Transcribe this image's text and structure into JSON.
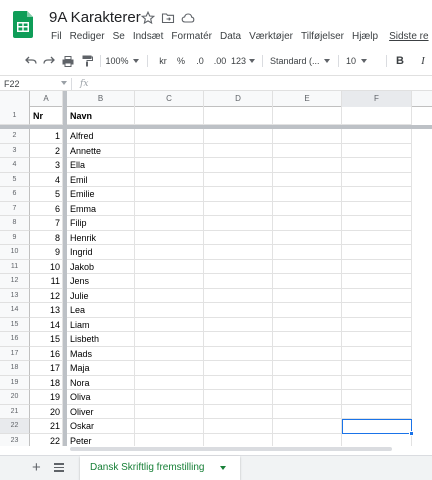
{
  "app": {
    "title": "9A Karakterer",
    "brand_color": "#0f9d58",
    "icons": [
      "star-icon",
      "move-to-folder-icon",
      "cloud-saved-icon"
    ]
  },
  "menu": {
    "items": [
      "Fil",
      "Rediger",
      "Se",
      "Indsæt",
      "Formatér",
      "Data",
      "Værktøjer",
      "Tilføjelser",
      "Hjælp"
    ],
    "last_edit": "Sidste re"
  },
  "toolbar": {
    "zoom": "100%",
    "currency": "kr",
    "percent": "%",
    "decrease_decimals": ".0",
    "increase_decimals": ".00",
    "more_formats": "123",
    "font": "Standard (...",
    "font_size": "10",
    "bold": "B",
    "italic": "I",
    "icons": [
      "undo-icon",
      "redo-icon",
      "print-icon",
      "paint-format-icon"
    ]
  },
  "formula_bar": {
    "name_box": "F22",
    "fx": "fx",
    "value": ""
  },
  "grid": {
    "columns": [
      "A",
      "B",
      "C",
      "D",
      "E",
      "F"
    ],
    "selected_column": "F",
    "selected_row": "22",
    "header_row": {
      "row": "1",
      "nr": "Nr",
      "navn": "Navn"
    },
    "rows": [
      {
        "row": "2",
        "nr": "1",
        "navn": "Alfred"
      },
      {
        "row": "3",
        "nr": "2",
        "navn": "Annette"
      },
      {
        "row": "4",
        "nr": "3",
        "navn": "Ella"
      },
      {
        "row": "5",
        "nr": "4",
        "navn": "Emil"
      },
      {
        "row": "6",
        "nr": "5",
        "navn": "Emilie"
      },
      {
        "row": "7",
        "nr": "6",
        "navn": "Emma"
      },
      {
        "row": "8",
        "nr": "7",
        "navn": "Filip"
      },
      {
        "row": "9",
        "nr": "8",
        "navn": "Henrik"
      },
      {
        "row": "10",
        "nr": "9",
        "navn": "Ingrid"
      },
      {
        "row": "11",
        "nr": "10",
        "navn": "Jakob"
      },
      {
        "row": "12",
        "nr": "11",
        "navn": "Jens"
      },
      {
        "row": "13",
        "nr": "12",
        "navn": "Julie"
      },
      {
        "row": "14",
        "nr": "13",
        "navn": "Lea"
      },
      {
        "row": "15",
        "nr": "14",
        "navn": "Liam"
      },
      {
        "row": "16",
        "nr": "15",
        "navn": "Lisbeth"
      },
      {
        "row": "17",
        "nr": "16",
        "navn": "Mads"
      },
      {
        "row": "18",
        "nr": "17",
        "navn": "Maja"
      },
      {
        "row": "19",
        "nr": "18",
        "navn": "Nora"
      },
      {
        "row": "20",
        "nr": "19",
        "navn": "Oliva"
      },
      {
        "row": "21",
        "nr": "20",
        "navn": "Oliver"
      },
      {
        "row": "22",
        "nr": "21",
        "navn": "Oskar"
      },
      {
        "row": "23",
        "nr": "22",
        "navn": "Peter"
      }
    ]
  },
  "sheets": {
    "active": "Dansk Skriftlig fremstilling",
    "icons": [
      "add-sheet-icon",
      "all-sheets-icon"
    ],
    "active_color": "#188038"
  }
}
